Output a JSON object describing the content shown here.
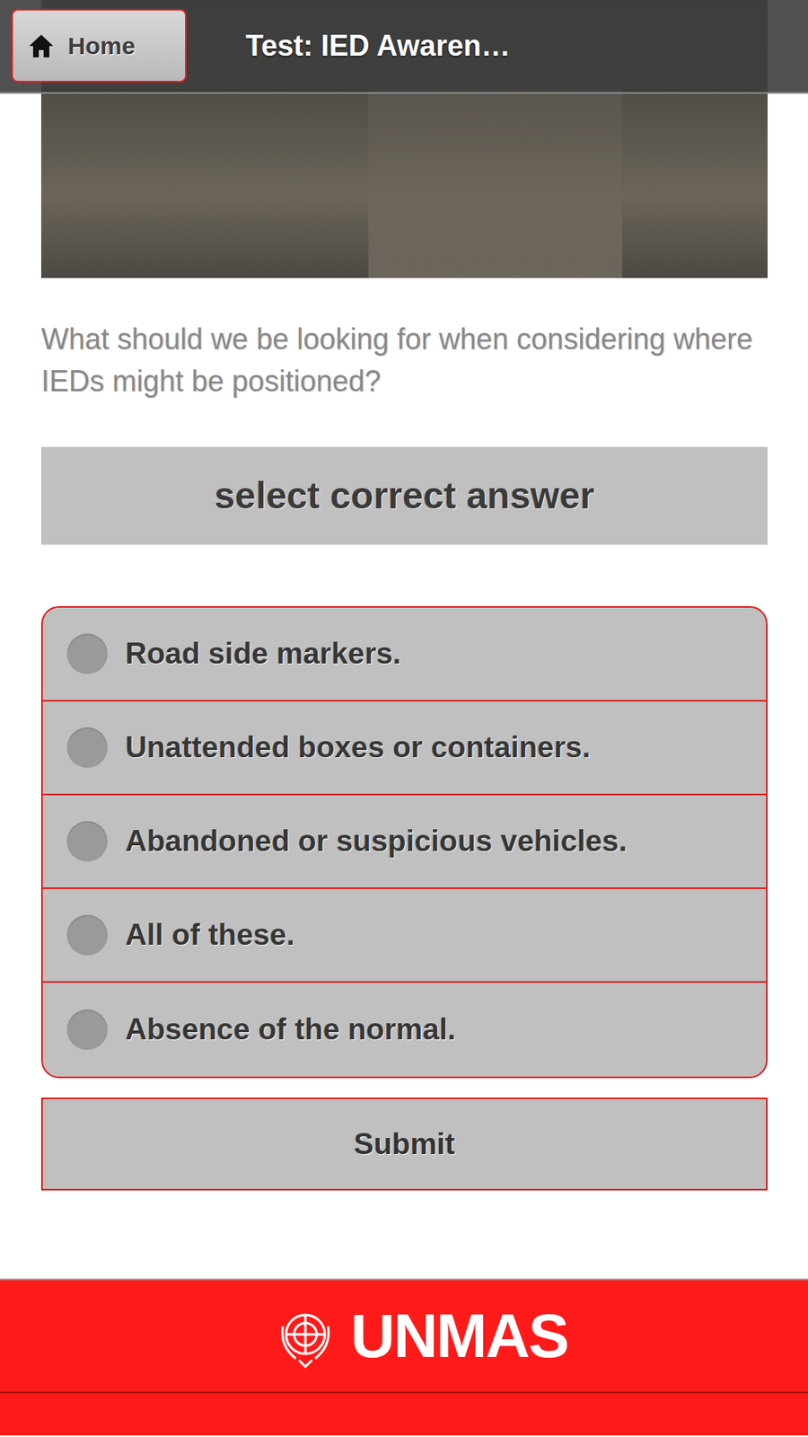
{
  "header": {
    "home_label": "Home",
    "title": "Test: IED Awaren…"
  },
  "question": "What should we be looking for when considering where IEDs might be positioned?",
  "prompt": "select correct answer",
  "options": [
    {
      "label": "Road side markers.",
      "selected": false
    },
    {
      "label": "Unattended boxes or containers.",
      "selected": false
    },
    {
      "label": "Abandoned or suspicious vehicles.",
      "selected": false
    },
    {
      "label": "All of these.",
      "selected": false
    },
    {
      "label": "Absence of the normal.",
      "selected": false
    }
  ],
  "submit": "Submit",
  "footer": {
    "logo_text": "UNMAS"
  }
}
